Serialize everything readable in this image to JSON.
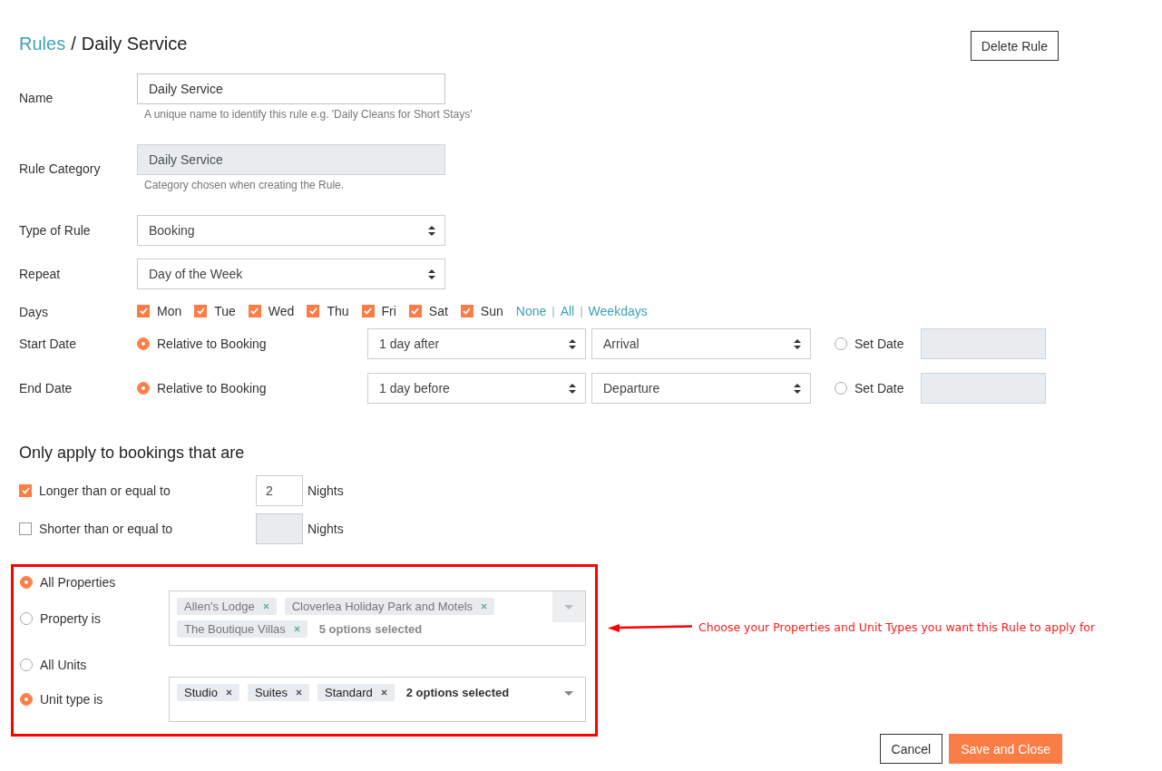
{
  "breadcrumb": {
    "parent": "Rules",
    "separator": "/",
    "current": "Daily Service"
  },
  "delete_button": "Delete Rule",
  "fields": [
    {
      "kind": "text",
      "label": "Name",
      "value": "Daily Service",
      "disabled": false,
      "help": "A unique name to identify this rule e.g. 'Daily Cleans for Short Stays'"
    },
    {
      "kind": "text",
      "label": "Rule Category",
      "value": "Daily Service",
      "disabled": true,
      "help": "Category chosen when creating the Rule."
    },
    {
      "kind": "select",
      "label": "Type of Rule",
      "value": "Booking"
    },
    {
      "kind": "select",
      "label": "Repeat",
      "value": "Day of the Week"
    }
  ],
  "days": {
    "label": "Days",
    "items": [
      {
        "label": "Mon",
        "checked": true
      },
      {
        "label": "Tue",
        "checked": true
      },
      {
        "label": "Wed",
        "checked": true
      },
      {
        "label": "Thu",
        "checked": true
      },
      {
        "label": "Fri",
        "checked": true
      },
      {
        "label": "Sat",
        "checked": true
      },
      {
        "label": "Sun",
        "checked": true
      }
    ],
    "shortcuts": [
      {
        "kind": "link",
        "text": "None"
      },
      {
        "kind": "separator",
        "text": "|"
      },
      {
        "kind": "link",
        "text": "All"
      },
      {
        "kind": "separator",
        "text": "|"
      },
      {
        "kind": "link",
        "text": "Weekdays"
      }
    ]
  },
  "dates": [
    {
      "label": "Start Date",
      "relative": {
        "label": "Relative to Booking",
        "selected": true
      },
      "offset": "1 day after",
      "anchor": "Arrival",
      "set_date": {
        "label": "Set Date",
        "selected": false
      }
    },
    {
      "label": "End Date",
      "relative": {
        "label": "Relative to Booking",
        "selected": true
      },
      "offset": "1 day before",
      "anchor": "Departure",
      "set_date": {
        "label": "Set Date",
        "selected": false
      }
    }
  ],
  "filters": {
    "title": "Only apply to bookings that are",
    "items": [
      {
        "label": "Longer than or equal to",
        "checked": true,
        "value": "2",
        "unit": "Nights"
      },
      {
        "label": "Shorter than or equal to",
        "checked": false,
        "unit": "Nights"
      }
    ]
  },
  "scope": {
    "groups": [
      {
        "options": [
          {
            "label": "All Properties",
            "selected": true
          },
          {
            "label": "Property is",
            "selected": false
          }
        ],
        "tags": [
          "Allen's Lodge",
          "Cloverlea Holiday Park and Motels",
          "The Boutique Villas"
        ],
        "summary": "5 options selected"
      },
      {
        "options": [
          {
            "label": "All Units",
            "selected": false
          },
          {
            "label": "Unit type is",
            "selected": true
          }
        ],
        "tags": [
          "Studio",
          "Suites",
          "Standard"
        ],
        "summary": "2 options selected"
      }
    ]
  },
  "annotation": {
    "text": "Choose your Properties and Unit Types you want this Rule to apply for"
  },
  "buttons": [
    {
      "kind": "secondary",
      "label": "Cancel"
    },
    {
      "kind": "primary",
      "label": "Save and Close"
    }
  ]
}
